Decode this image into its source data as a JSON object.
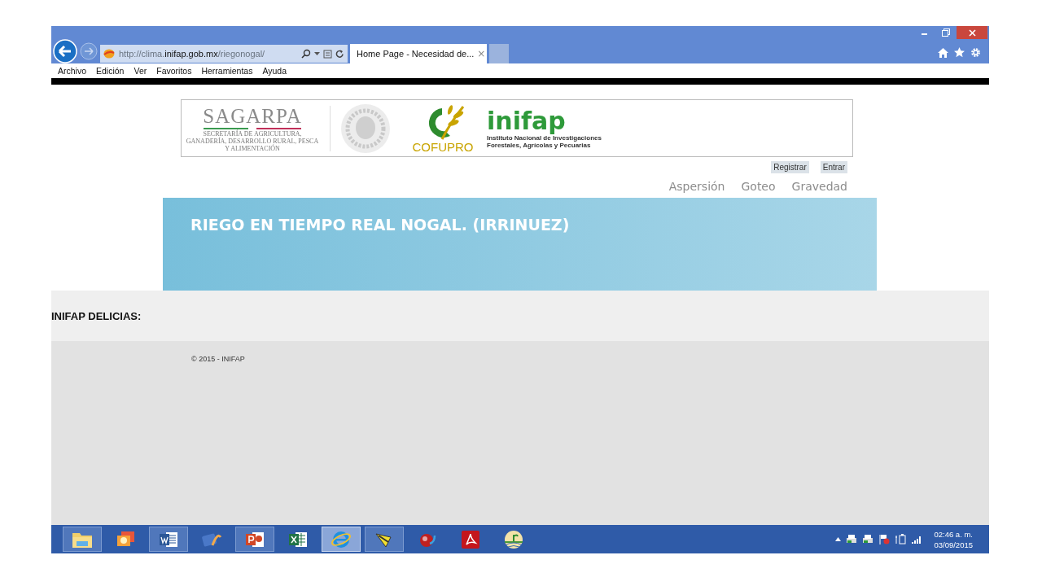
{
  "browser": {
    "address": [
      {
        "text": "http://clima.",
        "emphasis": false
      },
      {
        "text": "inifap.gob.mx",
        "emphasis": true
      },
      {
        "text": "/riegonogal/",
        "emphasis": false
      }
    ],
    "tabs": [
      {
        "title": "Home Page - Necesidad de...",
        "selected": true
      }
    ],
    "close_tab": "×",
    "menu": [
      "Archivo",
      "Edición",
      "Ver",
      "Favoritos",
      "Herramientas",
      "Ayuda"
    ]
  },
  "banner": {
    "sagarpa": "SAGARPA",
    "sagarpa_subtitle": "SECRETARÍA DE AGRICULTURA, GANADERÍA, DESARROLLO RURAL, PESCA Y ALIMENTACIÓN",
    "cofupro": "COFUPRO",
    "inifap": "inifap",
    "inifap_subtitle": "Instituto Nacional de Investigaciones Forestales, Agrícolas y Pecuarias"
  },
  "account_links": [
    "Registrar",
    "Entrar"
  ],
  "nav": [
    "Aspersión",
    "Goteo",
    "Gravedad"
  ],
  "hero": {
    "title": "RIEGO EN TIEMPO REAL NOGAL. (IRRINUEZ)"
  },
  "section": {
    "title": "INIFAP DELICIAS:"
  },
  "footer": {
    "text": "© 2015 - INIFAP"
  },
  "taskbar": {
    "apps": [
      {
        "kind": "folder",
        "running": true,
        "selected": false
      },
      {
        "kind": "photos",
        "running": false,
        "selected": false
      },
      {
        "kind": "word",
        "running": true,
        "selected": false
      },
      {
        "kind": "media",
        "running": false,
        "selected": false
      },
      {
        "kind": "powerpoint",
        "running": true,
        "selected": false
      },
      {
        "kind": "excel",
        "running": false,
        "selected": false
      },
      {
        "kind": "browser",
        "running": true,
        "selected": true
      },
      {
        "kind": "tool",
        "running": true,
        "selected": false
      },
      {
        "kind": "dictionary",
        "running": false,
        "selected": false
      },
      {
        "kind": "acrobat",
        "running": false,
        "selected": false
      },
      {
        "kind": "globe",
        "running": false,
        "selected": false
      }
    ],
    "time": "02:46 a. m.",
    "date": "03/09/2015"
  }
}
